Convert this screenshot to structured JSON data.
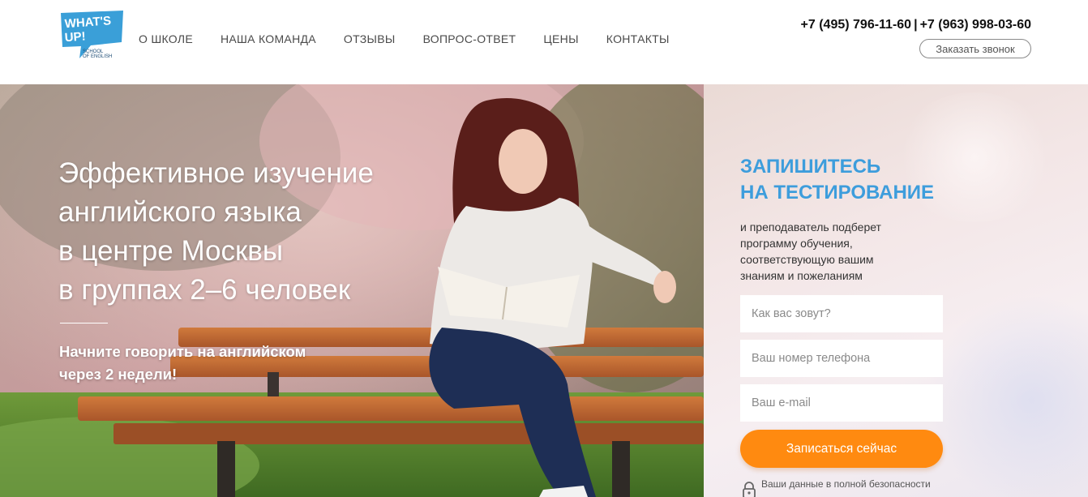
{
  "header": {
    "logo": {
      "line1": "WHAT'S",
      "line2": "UP!",
      "line3": "SCHOOL",
      "line4": "OF ENGLISH",
      "icon": "speech-bubble-logo"
    },
    "nav": [
      {
        "label": "О ШКОЛЕ"
      },
      {
        "label": "НАША КОМАНДА"
      },
      {
        "label": "ОТЗЫВЫ"
      },
      {
        "label": "ВОПРОС-ОТВЕТ"
      },
      {
        "label": "ЦЕНЫ"
      },
      {
        "label": "КОНТАКТЫ"
      }
    ],
    "phone1": "+7 (495) 796-11-60",
    "separator": "|",
    "phone2": "+7 (963) 998-03-60",
    "callback_label": "Заказать звонок"
  },
  "hero": {
    "title_lines": [
      "Эффективное изучение",
      "английского языка",
      "в центре Москвы",
      "в группах 2–6 человек"
    ],
    "subtitle_lines": [
      "Начните говорить на английском",
      "через 2 недели!"
    ],
    "image": "woman-reading-book-on-bench-photo"
  },
  "form": {
    "title_lines": [
      "ЗАПИШИТЕСЬ",
      "НА ТЕСТИРОВАНИЕ"
    ],
    "description_lines": [
      "и преподаватель подберет",
      "программу обучения,",
      "соответствующую вашим",
      "знаниям и пожеланиям"
    ],
    "name_placeholder": "Как вас зовут?",
    "phone_placeholder": "Ваш номер телефона",
    "email_placeholder": "Ваш e-mail",
    "submit_label": "Записаться сейчас",
    "privacy_text": "Ваши данные в полной безопасности",
    "privacy_icon": "lock-icon"
  },
  "colors": {
    "accent_blue": "#3d9ddc",
    "button_orange": "#ff8a10",
    "logo_blue": "#3a9fd8"
  }
}
